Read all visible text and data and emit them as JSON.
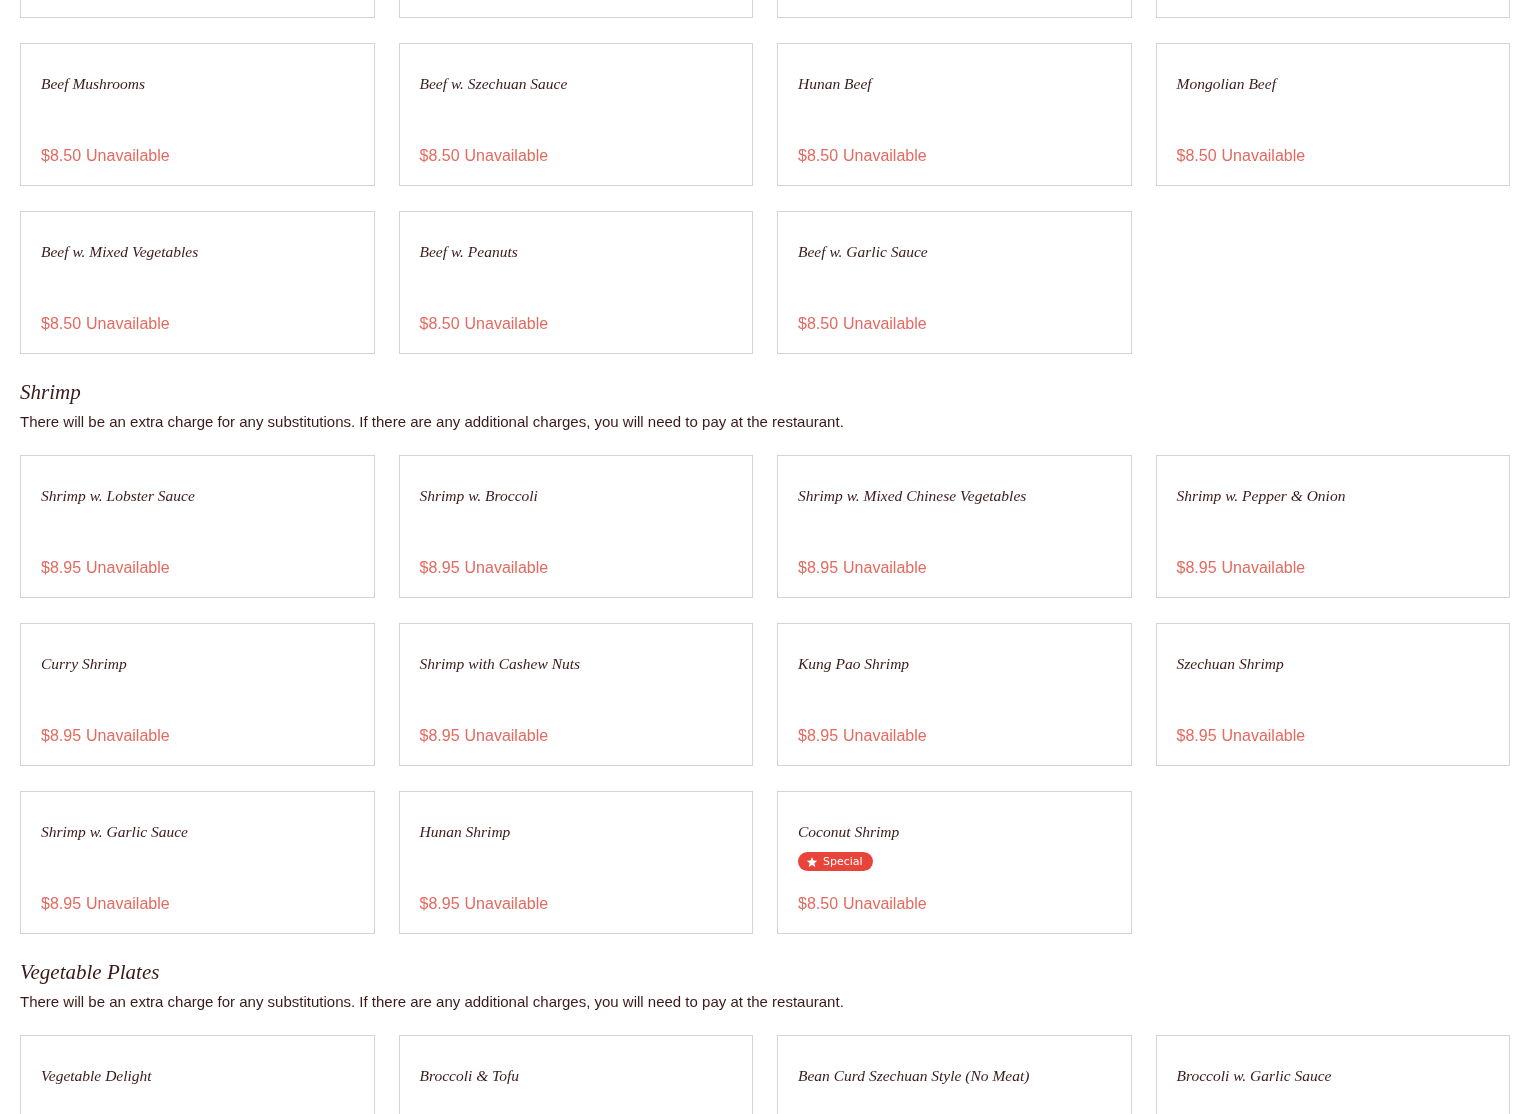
{
  "sections": [
    {
      "items": [
        {
          "name": "Beef Mushrooms",
          "price": "$8.50",
          "availability": "Unavailable"
        },
        {
          "name": "Beef w. Szechuan Sauce",
          "price": "$8.50",
          "availability": "Unavailable"
        },
        {
          "name": "Hunan Beef",
          "price": "$8.50",
          "availability": "Unavailable"
        },
        {
          "name": "Mongolian Beef",
          "price": "$8.50",
          "availability": "Unavailable"
        },
        {
          "name": "Beef w. Mixed Vegetables",
          "price": "$8.50",
          "availability": "Unavailable"
        },
        {
          "name": "Beef w. Peanuts",
          "price": "$8.50",
          "availability": "Unavailable"
        },
        {
          "name": "Beef w. Garlic Sauce",
          "price": "$8.50",
          "availability": "Unavailable"
        }
      ]
    },
    {
      "title": "Shrimp",
      "note": "There will be an extra charge for any substitutions. If there are any additional charges, you will need to pay at the restaurant.",
      "items": [
        {
          "name": "Shrimp w. Lobster Sauce",
          "price": "$8.95",
          "availability": "Unavailable"
        },
        {
          "name": "Shrimp w. Broccoli",
          "price": "$8.95",
          "availability": "Unavailable"
        },
        {
          "name": "Shrimp w. Mixed Chinese Vegetables",
          "price": "$8.95",
          "availability": "Unavailable"
        },
        {
          "name": "Shrimp w. Pepper & Onion",
          "price": "$8.95",
          "availability": "Unavailable"
        },
        {
          "name": "Curry Shrimp",
          "price": "$8.95",
          "availability": "Unavailable"
        },
        {
          "name": "Shrimp with Cashew Nuts",
          "price": "$8.95",
          "availability": "Unavailable"
        },
        {
          "name": "Kung Pao Shrimp",
          "price": "$8.95",
          "availability": "Unavailable"
        },
        {
          "name": "Szechuan Shrimp",
          "price": "$8.95",
          "availability": "Unavailable"
        },
        {
          "name": "Shrimp w. Garlic Sauce",
          "price": "$8.95",
          "availability": "Unavailable"
        },
        {
          "name": "Hunan Shrimp",
          "price": "$8.95",
          "availability": "Unavailable"
        },
        {
          "name": "Coconut Shrimp",
          "badge": "Special",
          "price": "$8.50",
          "availability": "Unavailable"
        }
      ]
    },
    {
      "title": "Vegetable Plates",
      "note": "There will be an extra charge for any substitutions. If there are any additional charges, you will need to pay at the restaurant.",
      "items": [
        {
          "name": "Vegetable Delight"
        },
        {
          "name": "Broccoli & Tofu"
        },
        {
          "name": "Bean Curd Szechuan Style (No Meat)"
        },
        {
          "name": "Broccoli w. Garlic Sauce"
        }
      ]
    }
  ]
}
